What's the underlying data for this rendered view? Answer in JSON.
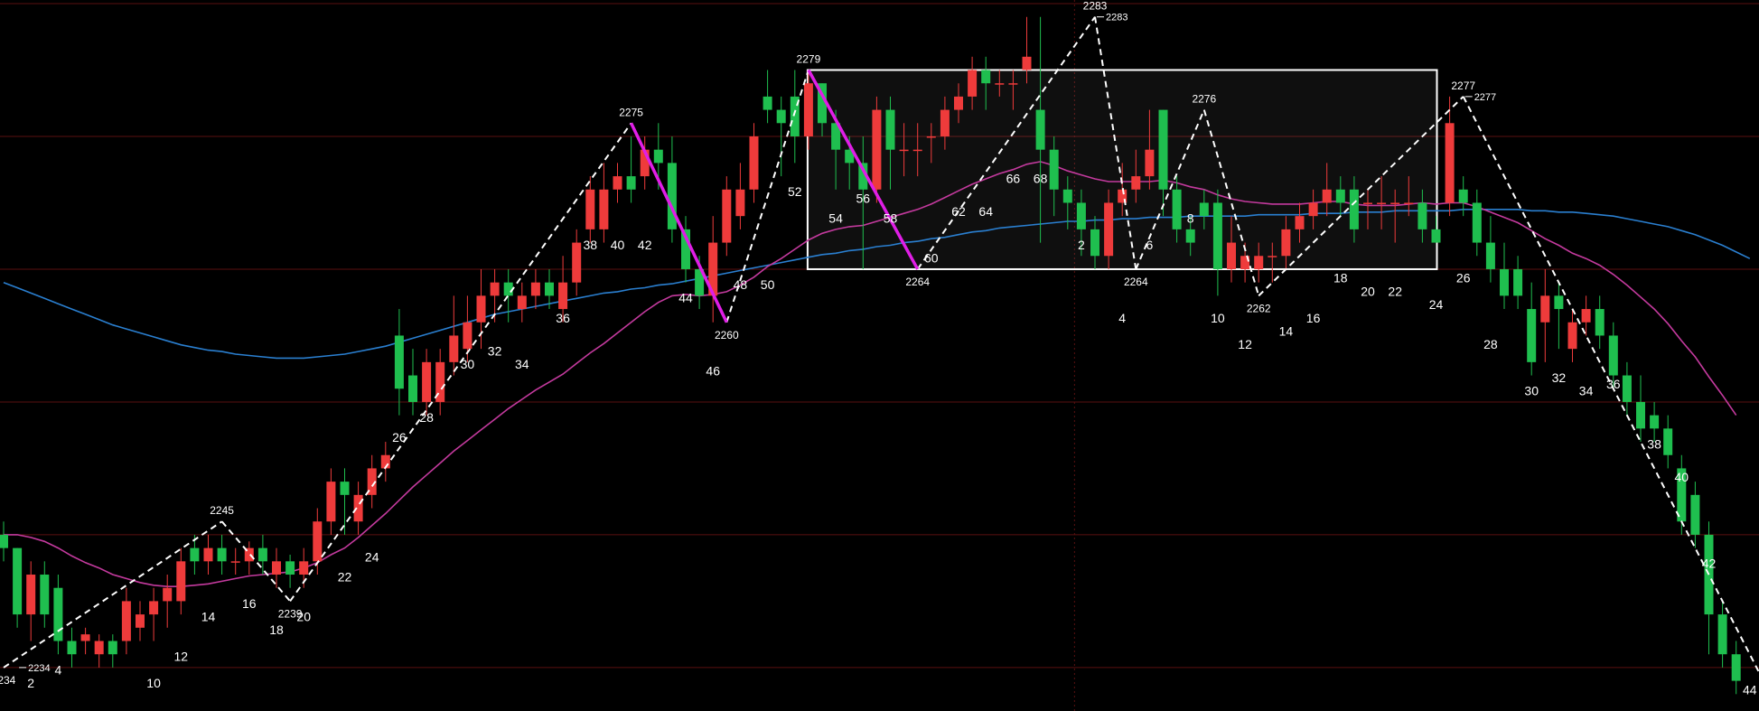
{
  "chart_data": {
    "type": "candlestick",
    "grid": true,
    "colors": {
      "background": "#000000",
      "up": "#ee3b3b",
      "down": "#1fbf4f",
      "ma_fast": "#c43a9e",
      "ma_slow": "#2a7fd0",
      "zigzag": "#ffffff",
      "highlight": "#e01ee6",
      "box": "#ffffff",
      "grid": "#5a1010",
      "label": "#ffffff"
    },
    "candles": [
      [
        2244,
        2243,
        2245,
        2242
      ],
      [
        2243,
        2238,
        2243,
        2237
      ],
      [
        2238,
        2241,
        2242,
        2236
      ],
      [
        2241,
        2238,
        2242,
        2237
      ],
      [
        2240,
        2236,
        2241,
        2235
      ],
      [
        2236,
        2235,
        2237,
        2234
      ],
      [
        2236,
        2236.5,
        2237,
        2235
      ],
      [
        2235,
        2236,
        2236.5,
        2234
      ],
      [
        2236,
        2235,
        2236.5,
        2234
      ],
      [
        2236,
        2239,
        2240,
        2235
      ],
      [
        2237,
        2238,
        2239,
        2236
      ],
      [
        2238,
        2239,
        2240,
        2236
      ],
      [
        2239,
        2240,
        2241,
        2237
      ],
      [
        2239,
        2242,
        2243,
        2238
      ],
      [
        2243,
        2242,
        2244,
        2241
      ],
      [
        2242,
        2243,
        2244,
        2241
      ],
      [
        2243,
        2242,
        2244,
        2241
      ],
      [
        2242,
        2242,
        2243,
        2241
      ],
      [
        2242,
        2243,
        2243.5,
        2241
      ],
      [
        2243,
        2242,
        2244,
        2241
      ],
      [
        2241,
        2242,
        2243,
        2240
      ],
      [
        2242,
        2241,
        2242.5,
        2240
      ],
      [
        2241,
        2242,
        2243,
        2240
      ],
      [
        2242,
        2245,
        2246,
        2241
      ],
      [
        2245,
        2248,
        2249,
        2244
      ],
      [
        2248,
        2247,
        2249,
        2244
      ],
      [
        2245,
        2247,
        2248,
        2244
      ],
      [
        2247,
        2249,
        2250,
        2246
      ],
      [
        2249,
        2250,
        2251,
        2248
      ],
      [
        2259,
        2255,
        2261,
        2253
      ],
      [
        2256,
        2254,
        2258,
        2253
      ],
      [
        2254,
        2257,
        2258,
        2253
      ],
      [
        2254,
        2257,
        2258,
        2253
      ],
      [
        2257,
        2259,
        2262,
        2256
      ],
      [
        2258,
        2260,
        2262,
        2257
      ],
      [
        2260,
        2262,
        2264,
        2258
      ],
      [
        2262,
        2263,
        2264,
        2260
      ],
      [
        2263,
        2262,
        2264,
        2260
      ],
      [
        2261,
        2262,
        2263,
        2260
      ],
      [
        2262,
        2263,
        2264,
        2261
      ],
      [
        2263,
        2262,
        2264,
        2261
      ],
      [
        2261,
        2263,
        2265,
        2260
      ],
      [
        2263,
        2266,
        2267,
        2262
      ],
      [
        2267,
        2270,
        2271,
        2266
      ],
      [
        2267,
        2270,
        2272,
        2266
      ],
      [
        2270,
        2271,
        2272,
        2269
      ],
      [
        2271,
        2270,
        2274,
        2269
      ],
      [
        2271,
        2273,
        2274,
        2270
      ],
      [
        2273,
        2272,
        2275,
        2270
      ],
      [
        2272,
        2267,
        2274,
        2266
      ],
      [
        2267,
        2264,
        2268,
        2263
      ],
      [
        2264,
        2262,
        2265,
        2261
      ],
      [
        2262,
        2266,
        2268,
        2260
      ],
      [
        2266,
        2270,
        2271,
        2265
      ],
      [
        2268,
        2270,
        2272,
        2267
      ],
      [
        2270,
        2274,
        2275,
        2269
      ],
      [
        2277,
        2276,
        2279,
        2275
      ],
      [
        2276,
        2275,
        2277,
        2271
      ],
      [
        2277,
        2274,
        2279,
        2272
      ],
      [
        2274,
        2278,
        2279,
        2273
      ],
      [
        2278,
        2275,
        2278,
        2274
      ],
      [
        2275,
        2273,
        2276,
        2270
      ],
      [
        2273,
        2272,
        2274,
        2270
      ],
      [
        2272,
        2270,
        2274,
        2264
      ],
      [
        2270,
        2276,
        2277,
        2269
      ],
      [
        2276,
        2273,
        2277,
        2270
      ],
      [
        2273,
        2273,
        2275,
        2271
      ],
      [
        2273,
        2273,
        2275,
        2271
      ],
      [
        2274,
        2274,
        2275,
        2272
      ],
      [
        2274,
        2276,
        2277,
        2273
      ],
      [
        2276,
        2277,
        2278,
        2275
      ],
      [
        2277,
        2279,
        2280,
        2276
      ],
      [
        2279,
        2278,
        2280,
        2276
      ],
      [
        2278,
        2278,
        2279,
        2277
      ],
      [
        2278,
        2278,
        2279,
        2276
      ],
      [
        2279,
        2280,
        2283,
        2278
      ],
      [
        2276,
        2273,
        2283,
        2266
      ],
      [
        2273,
        2270,
        2274,
        2268
      ],
      [
        2270,
        2269,
        2271,
        2267
      ],
      [
        2269,
        2267,
        2270,
        2265
      ],
      [
        2267,
        2265,
        2268,
        2264
      ],
      [
        2265,
        2269,
        2270,
        2264
      ],
      [
        2269,
        2270,
        2272,
        2268
      ],
      [
        2270,
        2271,
        2273,
        2269
      ],
      [
        2271,
        2273,
        2276,
        2270
      ],
      [
        2276,
        2270,
        2276,
        2268
      ],
      [
        2270,
        2267,
        2271,
        2266
      ],
      [
        2267,
        2266,
        2268,
        2265
      ],
      [
        2269,
        2268,
        2270,
        2267
      ],
      [
        2269,
        2264,
        2270,
        2262
      ],
      [
        2264,
        2266,
        2268,
        2263
      ],
      [
        2264,
        2265,
        2266,
        2263
      ],
      [
        2264,
        2265,
        2266,
        2263
      ],
      [
        2265,
        2265,
        2266,
        2263
      ],
      [
        2265,
        2267,
        2268,
        2264
      ],
      [
        2267,
        2268,
        2269,
        2266
      ],
      [
        2268,
        2269,
        2270,
        2267
      ],
      [
        2269,
        2270,
        2272,
        2268
      ],
      [
        2270,
        2269,
        2271,
        2268
      ],
      [
        2270,
        2267,
        2271,
        2266
      ],
      [
        2269,
        2269,
        2270,
        2267
      ],
      [
        2269,
        2269,
        2271,
        2267
      ],
      [
        2269,
        2269,
        2270,
        2266
      ],
      [
        2269,
        2269,
        2271,
        2268
      ],
      [
        2269,
        2267,
        2270,
        2266
      ],
      [
        2267,
        2266,
        2268,
        2266
      ],
      [
        2269,
        2275,
        2277,
        2268
      ],
      [
        2270,
        2269,
        2271,
        2268
      ],
      [
        2269,
        2266,
        2270,
        2265
      ],
      [
        2266,
        2264,
        2268,
        2263
      ],
      [
        2264,
        2262,
        2266,
        2261
      ],
      [
        2264,
        2262,
        2265,
        2261
      ],
      [
        2261,
        2257,
        2263,
        2256
      ],
      [
        2260,
        2262,
        2264,
        2257
      ],
      [
        2262,
        2261,
        2263,
        2258
      ],
      [
        2258,
        2260,
        2261,
        2257
      ],
      [
        2260,
        2261,
        2262,
        2259
      ],
      [
        2261,
        2259,
        2262,
        2258
      ],
      [
        2259,
        2256,
        2260,
        2255
      ],
      [
        2256,
        2254,
        2257,
        2253
      ],
      [
        2254,
        2252,
        2256,
        2251
      ],
      [
        2253,
        2252,
        2254,
        2251
      ],
      [
        2252,
        2250,
        2253,
        2249
      ],
      [
        2249,
        2245,
        2250,
        2244
      ],
      [
        2247,
        2244,
        2248,
        2243
      ],
      [
        2244,
        2238,
        2245,
        2235
      ],
      [
        2238,
        2235,
        2239,
        2234
      ],
      [
        2235,
        2233,
        2236,
        2232
      ]
    ],
    "ma_fast": [
      2244,
      2244,
      2243.8,
      2243.5,
      2243,
      2242.4,
      2241.9,
      2241.5,
      2241,
      2240.7,
      2240.4,
      2240.2,
      2240.1,
      2240.1,
      2240.2,
      2240.3,
      2240.5,
      2240.7,
      2240.9,
      2241,
      2241.1,
      2241.2,
      2241.5,
      2241.9,
      2242.5,
      2243,
      2243.8,
      2244.7,
      2245.6,
      2246.6,
      2247.6,
      2248.5,
      2249.4,
      2250.3,
      2251.1,
      2251.9,
      2252.7,
      2253.5,
      2254.2,
      2254.9,
      2255.5,
      2256.1,
      2256.9,
      2257.7,
      2258.4,
      2259.2,
      2260,
      2260.8,
      2261.5,
      2262,
      2262.1,
      2262,
      2262.1,
      2262.3,
      2262.8,
      2263.4,
      2264.2,
      2264.8,
      2265.5,
      2266.2,
      2266.7,
      2267,
      2267.2,
      2267.3,
      2267.6,
      2267.9,
      2268.2,
      2268.5,
      2268.9,
      2269.4,
      2269.9,
      2270.4,
      2270.8,
      2271.2,
      2271.5,
      2271.9,
      2272.1,
      2271.8,
      2271.4,
      2271.1,
      2270.8,
      2270.6,
      2270.6,
      2270.6,
      2270.6,
      2270.7,
      2270.5,
      2270.2,
      2270,
      2269.6,
      2269.3,
      2269.1,
      2269,
      2268.9,
      2268.9,
      2268.9,
      2269,
      2269.1,
      2269.1,
      2268.9,
      2268.8,
      2268.8,
      2268.8,
      2268.9,
      2269,
      2268.9,
      2269,
      2269,
      2268.7,
      2268.3,
      2267.9,
      2267.5,
      2266.9,
      2266.3,
      2265.8,
      2265.2,
      2264.8,
      2264.3,
      2263.6,
      2262.8,
      2261.9,
      2261,
      2259.9,
      2258.6,
      2257.4,
      2255.9,
      2254.5,
      2253
    ],
    "ma_slow": [
      2263,
      2262.6,
      2262.2,
      2261.8,
      2261.4,
      2261,
      2260.6,
      2260.2,
      2259.8,
      2259.5,
      2259.2,
      2258.9,
      2258.6,
      2258.3,
      2258.1,
      2257.9,
      2257.8,
      2257.6,
      2257.5,
      2257.4,
      2257.3,
      2257.3,
      2257.3,
      2257.4,
      2257.5,
      2257.6,
      2257.8,
      2258,
      2258.2,
      2258.5,
      2258.8,
      2259.1,
      2259.4,
      2259.7,
      2260,
      2260.3,
      2260.6,
      2260.8,
      2261,
      2261.2,
      2261.4,
      2261.6,
      2261.8,
      2262,
      2262.2,
      2262.3,
      2262.5,
      2262.6,
      2262.8,
      2262.9,
      2263.1,
      2263.3,
      2263.5,
      2263.7,
      2263.9,
      2264.1,
      2264.3,
      2264.5,
      2264.7,
      2264.9,
      2265.1,
      2265.2,
      2265.4,
      2265.5,
      2265.7,
      2265.8,
      2266,
      2266.1,
      2266.3,
      2266.4,
      2266.6,
      2266.8,
      2266.9,
      2267.1,
      2267.2,
      2267.3,
      2267.4,
      2267.5,
      2267.6,
      2267.6,
      2267.7,
      2267.7,
      2267.8,
      2267.8,
      2267.9,
      2267.9,
      2267.9,
      2268,
      2268,
      2268,
      2268,
      2268,
      2268.1,
      2268.1,
      2268.1,
      2268.1,
      2268.2,
      2268.2,
      2268.2,
      2268.3,
      2268.3,
      2268.3,
      2268.4,
      2268.4,
      2268.4,
      2268.4,
      2268.4,
      2268.5,
      2268.5,
      2268.5,
      2268.5,
      2268.5,
      2268.4,
      2268.4,
      2268.3,
      2268.3,
      2268.2,
      2268.1,
      2268,
      2267.8,
      2267.6,
      2267.4,
      2267.2,
      2266.9,
      2266.6,
      2266.2,
      2265.8,
      2265.3,
      2264.8
    ],
    "zigzag": [
      {
        "i": 0,
        "price": 2234,
        "label": "2234",
        "pos": "below"
      },
      {
        "i": 16,
        "price": 2245,
        "label": "2245",
        "pos": "above"
      },
      {
        "i": 21,
        "price": 2239,
        "label": "2239",
        "pos": "below"
      },
      {
        "i": 46,
        "price": 2275,
        "label": "2275",
        "pos": "above"
      },
      {
        "i": 53,
        "price": 2260,
        "label": "2260",
        "pos": "below"
      },
      {
        "i": 59,
        "price": 2279,
        "label": "2279",
        "pos": "above"
      },
      {
        "i": 67,
        "price": 2264,
        "label": "2264",
        "pos": "below"
      },
      {
        "i": 80,
        "price": 2283,
        "label": "2283",
        "pos": "above"
      },
      {
        "i": 83,
        "price": 2264,
        "label": "2264",
        "pos": "below"
      },
      {
        "i": 88,
        "price": 2276,
        "label": "2276",
        "pos": "above"
      },
      {
        "i": 92,
        "price": 2262,
        "label": "2262",
        "pos": "below"
      },
      {
        "i": 107,
        "price": 2277,
        "label": "2277",
        "pos": "above"
      },
      {
        "i": 130,
        "price": 2231,
        "label": "",
        "pos": "below"
      }
    ],
    "price_tags": [
      {
        "i": 1,
        "price": 2234,
        "label": "2234"
      },
      {
        "i": 80,
        "price": 2283,
        "label": "2283"
      },
      {
        "i": 107,
        "price": 2277,
        "label": "2277"
      }
    ],
    "highlight_legs": [
      {
        "from": 3,
        "to": 4
      },
      {
        "from": 5,
        "to": 6
      }
    ],
    "box": {
      "i_start": 59,
      "i_end": 105,
      "price_top": 2279,
      "price_bottom": 2264
    },
    "y_range": [
      2231,
      2284
    ],
    "count_labels": [
      {
        "text": "2",
        "i": 2,
        "price": 2232.5
      },
      {
        "text": "4",
        "i": 4,
        "price": 2233.5
      },
      {
        "text": "10",
        "i": 11,
        "price": 2232.5
      },
      {
        "text": "12",
        "i": 13,
        "price": 2234.5
      },
      {
        "text": "14",
        "i": 15,
        "price": 2237.5
      },
      {
        "text": "16",
        "i": 18,
        "price": 2238.5
      },
      {
        "text": "18",
        "i": 20,
        "price": 2236.5
      },
      {
        "text": "20",
        "i": 22,
        "price": 2237.5
      },
      {
        "text": "22",
        "i": 25,
        "price": 2240.5
      },
      {
        "text": "24",
        "i": 27,
        "price": 2242
      },
      {
        "text": "26",
        "i": 29,
        "price": 2251
      },
      {
        "text": "28",
        "i": 31,
        "price": 2252.5
      },
      {
        "text": "30",
        "i": 34,
        "price": 2256.5
      },
      {
        "text": "32",
        "i": 36,
        "price": 2257.5
      },
      {
        "text": "34",
        "i": 38,
        "price": 2256.5
      },
      {
        "text": "36",
        "i": 41,
        "price": 2260
      },
      {
        "text": "38",
        "i": 43,
        "price": 2265.5
      },
      {
        "text": "40",
        "i": 45,
        "price": 2265.5
      },
      {
        "text": "42",
        "i": 47,
        "price": 2265.5
      },
      {
        "text": "44",
        "i": 50,
        "price": 2261.5
      },
      {
        "text": "46",
        "i": 52,
        "price": 2256
      },
      {
        "text": "48",
        "i": 54,
        "price": 2262.5
      },
      {
        "text": "50",
        "i": 56,
        "price": 2262.5
      },
      {
        "text": "52",
        "i": 58,
        "price": 2269.5
      },
      {
        "text": "54",
        "i": 61,
        "price": 2267.5
      },
      {
        "text": "56",
        "i": 63,
        "price": 2269
      },
      {
        "text": "58",
        "i": 65,
        "price": 2267.5
      },
      {
        "text": "60",
        "i": 68,
        "price": 2264.5
      },
      {
        "text": "62",
        "i": 70,
        "price": 2268
      },
      {
        "text": "64",
        "i": 72,
        "price": 2268
      },
      {
        "text": "66",
        "i": 74,
        "price": 2270.5
      },
      {
        "text": "68",
        "i": 76,
        "price": 2270.5
      },
      {
        "text": "2",
        "i": 79,
        "price": 2265.5
      },
      {
        "text": "4",
        "i": 82,
        "price": 2260
      },
      {
        "text": "6",
        "i": 84,
        "price": 2265.5
      },
      {
        "text": "8",
        "i": 87,
        "price": 2267.5
      },
      {
        "text": "10",
        "i": 89,
        "price": 2260
      },
      {
        "text": "12",
        "i": 91,
        "price": 2258
      },
      {
        "text": "14",
        "i": 94,
        "price": 2259
      },
      {
        "text": "16",
        "i": 96,
        "price": 2260
      },
      {
        "text": "18",
        "i": 98,
        "price": 2263
      },
      {
        "text": "20",
        "i": 100,
        "price": 2262
      },
      {
        "text": "22",
        "i": 102,
        "price": 2262
      },
      {
        "text": "24",
        "i": 105,
        "price": 2261
      },
      {
        "text": "26",
        "i": 107,
        "price": 2263
      },
      {
        "text": "28",
        "i": 109,
        "price": 2258
      },
      {
        "text": "30",
        "i": 112,
        "price": 2254.5
      },
      {
        "text": "32",
        "i": 114,
        "price": 2255.5
      },
      {
        "text": "34",
        "i": 116,
        "price": 2254.5
      },
      {
        "text": "36",
        "i": 118,
        "price": 2255
      },
      {
        "text": "38",
        "i": 121,
        "price": 2250.5
      },
      {
        "text": "40",
        "i": 123,
        "price": 2248
      },
      {
        "text": "42",
        "i": 125,
        "price": 2241.5
      },
      {
        "text": "44",
        "i": 128,
        "price": 2232
      }
    ]
  }
}
